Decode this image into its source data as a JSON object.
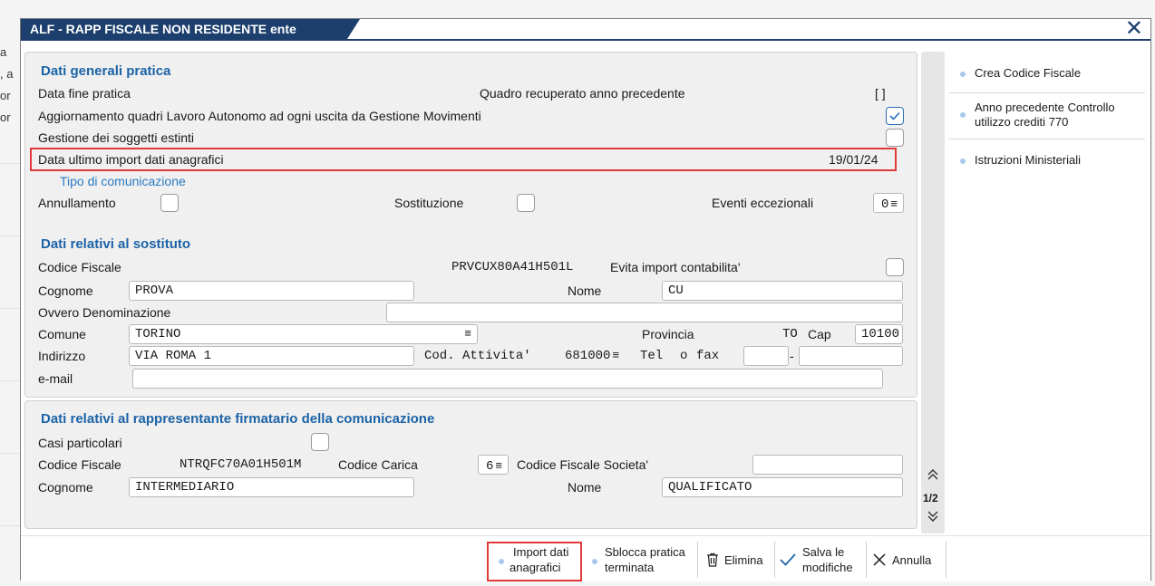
{
  "background": {
    "crumbs": [
      "a",
      ", a",
      "or",
      "or"
    ]
  },
  "dialog": {
    "title": "ALF - RAPP FISCALE NON RESIDENTE ente",
    "close_icon": "close-icon"
  },
  "section_general": {
    "title": "Dati generali pratica",
    "data_fine_pratica": "Data fine pratica",
    "quadro_recuperato": "Quadro recuperato anno precedente",
    "quadro_recuperato_value": "[ ]",
    "aggiornamento_quadri": "Aggiornamento quadri Lavoro Autonomo ad ogni uscita da Gestione Movimenti",
    "gestione_soggetti": "Gestione dei soggetti estinti",
    "data_ultimo_import": "Data ultimo import dati anagrafici",
    "data_ultimo_import_value": "19/01/24",
    "tipo_comunicazione": "Tipo di comunicazione",
    "annullamento": "Annullamento",
    "sostituzione": "Sostituzione",
    "eventi_eccezionali": "Eventi eccezionali",
    "eventi_eccezionali_value": "0"
  },
  "section_sostituto": {
    "title": "Dati relativi al sostituto",
    "codice_fiscale_label": "Codice Fiscale",
    "codice_fiscale_value": "PRVCUX80A41H501L",
    "evita_import": "Evita import contabilita'",
    "cognome_label": "Cognome",
    "cognome_value": "PROVA",
    "nome_label": "Nome",
    "nome_value": "CU",
    "ovvero_label": "Ovvero Denominazione",
    "ovvero_value": "",
    "comune_label": "Comune",
    "comune_value": "TORINO",
    "provincia_label": "Provincia",
    "provincia_value": "TO",
    "cap_label": "Cap",
    "cap_value": "10100",
    "indirizzo_label": "Indirizzo",
    "indirizzo_value": "VIA ROMA 1",
    "cod_attivita_label": "Cod. Attivita'",
    "cod_attivita_value": "681000",
    "tel_label": "Tel",
    "o_label": "o",
    "fax_label": "fax",
    "tel_sep": "-",
    "email_label": "e-mail",
    "email_value": ""
  },
  "section_rappresentante": {
    "title": "Dati relativi al rappresentante firmatario della comunicazione",
    "casi_particolari": "Casi particolari",
    "codice_fiscale_label": "Codice Fiscale",
    "codice_fiscale_value": "NTRQFC70A01H501M",
    "codice_carica_label": "Codice Carica",
    "codice_carica_value": "6",
    "cf_societa_label": "Codice Fiscale Societa'",
    "cf_societa_value": "",
    "cognome_label": "Cognome",
    "cognome_value": "INTERMEDIARIO",
    "nome_label": "Nome",
    "nome_value": "QUALIFICATO"
  },
  "pager": {
    "page": "1/2",
    "up_icon": "double-chevron-up-icon",
    "down_icon": "double-chevron-down-icon"
  },
  "side_actions": [
    {
      "label": "Crea Codice Fiscale"
    },
    {
      "label_line1": "Anno precedente Controllo",
      "label_line2": "utilizzo crediti 770"
    },
    {
      "label": "Istruzioni Ministeriali"
    }
  ],
  "bottom_buttons": {
    "import_line1": "Import dati",
    "import_line2": "anagrafici",
    "sblocca_line1": "Sblocca pratica",
    "sblocca_line2": "terminata",
    "elimina": "Elimina",
    "salva_line1": "Salva le",
    "salva_line2": "modifiche",
    "annulla": "Annulla"
  },
  "colors": {
    "title_bar": "#1c3f6e",
    "section_title": "#1c63a8",
    "highlight": "#e03a3a",
    "action_dot": "#a9c8ec"
  }
}
